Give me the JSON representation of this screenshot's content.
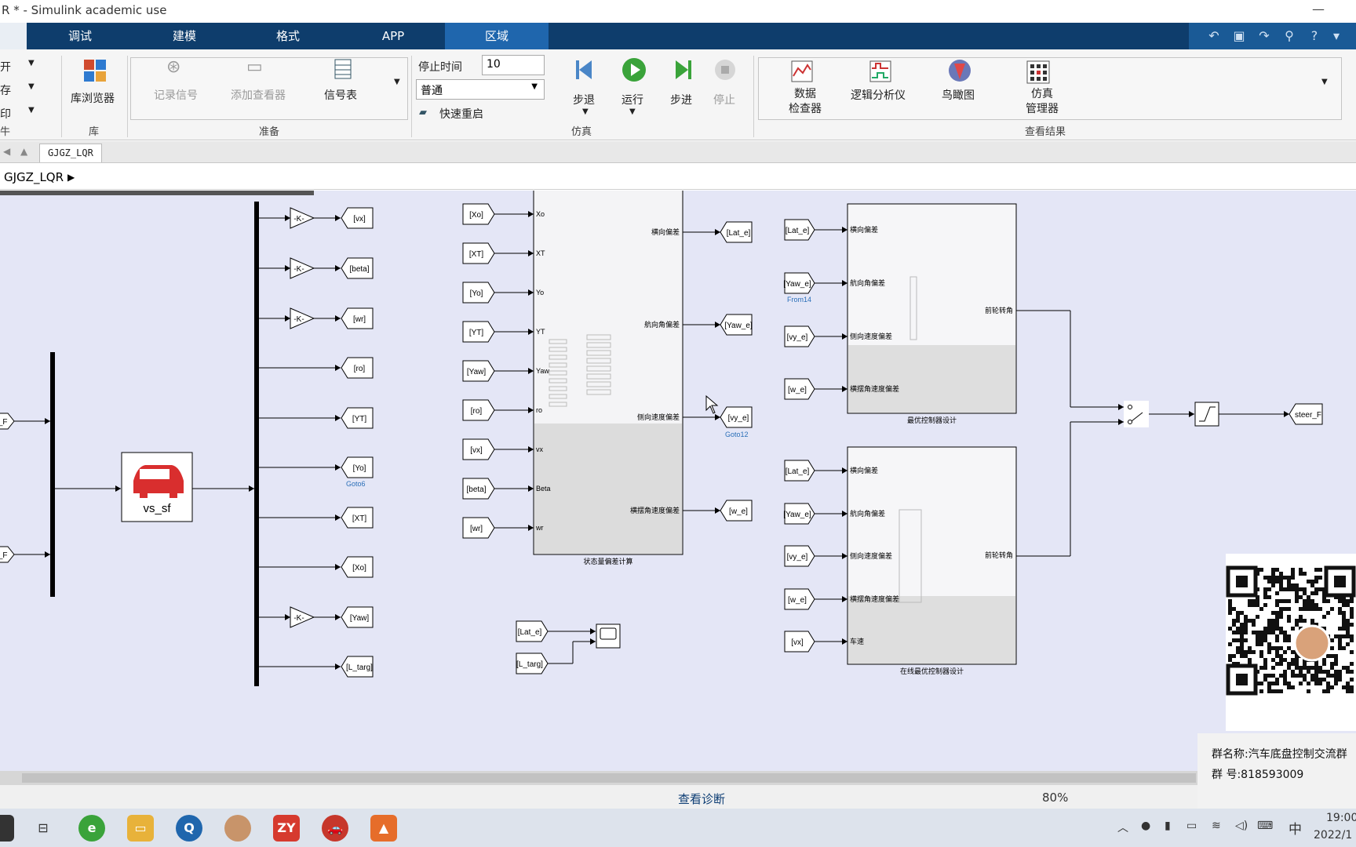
{
  "window": {
    "title": "R * - Simulink academic use",
    "minimize": "—"
  },
  "tabs": [
    {
      "label": "调试",
      "active": false
    },
    {
      "label": "建模",
      "active": false
    },
    {
      "label": "格式",
      "active": false
    },
    {
      "label": "APP",
      "active": false
    },
    {
      "label": "区域",
      "active": true
    }
  ],
  "ribbon": {
    "left_items": [
      "开",
      "存",
      "印"
    ],
    "left_section": "牛",
    "library": {
      "label": "库浏览器",
      "section": "库"
    },
    "prepare": {
      "log_signal": "记录信号",
      "add_viewer": "添加查看器",
      "signal_table": "信号表",
      "section": "准备"
    },
    "simulation": {
      "stop_time_label": "停止时间",
      "stop_time_value": "10",
      "mode": "普通",
      "fast_restart": "快速重启",
      "step_back": "步退",
      "run": "运行",
      "step_forward": "步进",
      "stop": "停止",
      "section": "仿真"
    },
    "results": {
      "data_inspector": "数据\n检查器",
      "logic_analyzer": "逻辑分析仪",
      "birds_eye": "鸟瞰图",
      "sim_manager": "仿真\n管理器",
      "section": "查看结果"
    }
  },
  "document_tab": "GJGZ_LQR",
  "breadcrumb": "GJGZ_LQR",
  "diagram": {
    "left_goto_partial": [
      "r_F",
      "r_F"
    ],
    "vehicle_block": "vs_sf",
    "demux_outputs": [
      {
        "tag": "[vx]",
        "gain": "-K-"
      },
      {
        "tag": "[beta]",
        "gain": "-K-"
      },
      {
        "tag": "[wr]",
        "gain": "-K-"
      },
      {
        "tag": "[ro]",
        "gain": ""
      },
      {
        "tag": "[YT]",
        "gain": ""
      },
      {
        "tag": "[Yo]",
        "gain": ""
      },
      {
        "tag": "[XT]",
        "gain": ""
      },
      {
        "tag": "[Xo]",
        "gain": ""
      },
      {
        "tag": "[Yaw]",
        "gain": "-K-"
      },
      {
        "tag": "[L_targ]",
        "gain": ""
      }
    ],
    "goto6_label": "Goto6",
    "state_block": {
      "inputs": [
        {
          "from": "[Xo]",
          "port": "Xo"
        },
        {
          "from": "[XT]",
          "port": "XT"
        },
        {
          "from": "[Yo]",
          "port": "Yo"
        },
        {
          "from": "[YT]",
          "port": "YT"
        },
        {
          "from": "[Yaw]",
          "port": "Yaw"
        },
        {
          "from": "[ro]",
          "port": "ro"
        },
        {
          "from": "[vx]",
          "port": "vx"
        },
        {
          "from": "[beta]",
          "port": "Beta"
        },
        {
          "from": "[wr]",
          "port": "wr"
        }
      ],
      "outputs": [
        {
          "port": "横向偏差",
          "to": "[Lat_e]"
        },
        {
          "port": "航向角偏差",
          "to": "[Yaw_e]"
        },
        {
          "port": "侧向速度偏差",
          "to": "[vy_e]"
        },
        {
          "port": "横摆角速度偏差",
          "to": "[w_e]"
        }
      ],
      "caption": "状态量偏差计算",
      "goto12_label": "Goto12"
    },
    "lqr_block": {
      "inputs": [
        {
          "from": "[Lat_e]",
          "port": "横向偏差"
        },
        {
          "from": "[Yaw_e]",
          "port": "航向角偏差"
        },
        {
          "from": "[vy_e]",
          "port": "侧向速度偏差"
        },
        {
          "from": "[w_e]",
          "port": "横摆角速度偏差"
        }
      ],
      "output": "前轮转角",
      "caption": "最优控制器设计",
      "from14_label": "From14"
    },
    "online_block": {
      "inputs": [
        {
          "from": "[Lat_e]",
          "port": "横向偏差"
        },
        {
          "from": "[Yaw_e]",
          "port": "航向角偏差"
        },
        {
          "from": "[vy_e]",
          "port": "侧向速度偏差"
        },
        {
          "from": "[w_e]",
          "port": "横摆角速度偏差"
        },
        {
          "from": "[vx]",
          "port": "车速"
        }
      ],
      "output": "前轮转角",
      "caption": "在线最优控制器设计"
    },
    "scope_inputs": [
      "[Lat_e]",
      "[L_targ]"
    ],
    "steer_goto": "steer_F"
  },
  "status": {
    "diagnostics": "查看诊断",
    "zoom": "80%"
  },
  "qr_panel": {
    "group_name": "群名称:汽车底盘控制交流群",
    "group_number": "群   号:818593009"
  },
  "taskbar": {
    "zy_label": "ZY",
    "ime": "中",
    "time": "19:00",
    "date": "2022/1"
  }
}
